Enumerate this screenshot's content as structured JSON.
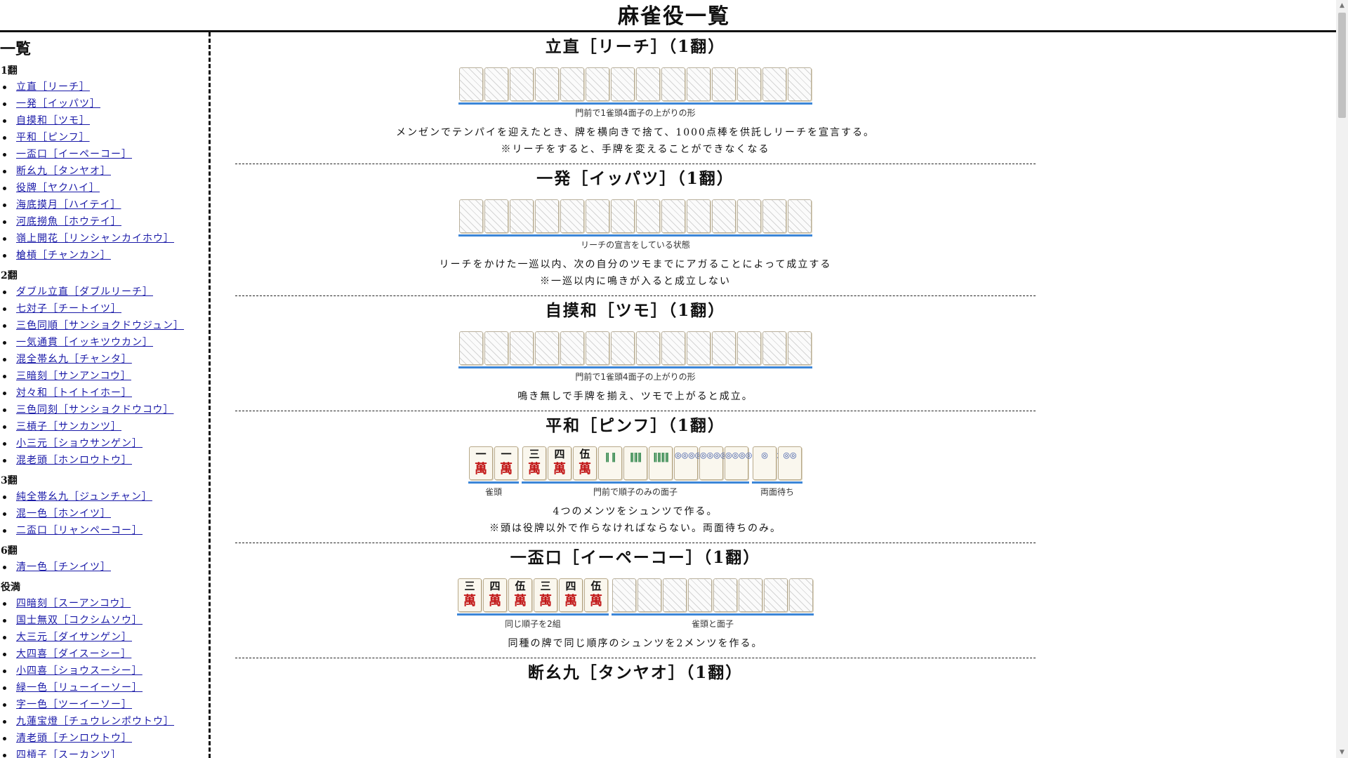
{
  "page": {
    "title": "麻雀役一覧"
  },
  "sidebar": {
    "heading": "一覧",
    "groups": [
      {
        "title": "1翻",
        "items": [
          "立直［リーチ］",
          "一発［イッパツ］",
          "自摸和［ツモ］",
          "平和［ピンフ］",
          "一盃口［イーペーコー］",
          "断幺九［タンヤオ］",
          "役牌［ヤクハイ］",
          "海底摸月［ハイテイ］",
          "河底撈魚［ホウテイ］",
          "嶺上開花［リンシャンカイホウ］",
          "槍槓［チャンカン］"
        ]
      },
      {
        "title": "2翻",
        "items": [
          "ダブル立直［ダブルリーチ］",
          "七対子［チートイツ］",
          "三色同順［サンショクドウジュン］",
          "一気通貫［イッキツウカン］",
          "混全帯幺九［チャンタ］",
          "三暗刻［サンアンコウ］",
          "対々和［トイトイホー］",
          "三色同刻［サンショクドウコウ］",
          "三槓子［サンカンツ］",
          "小三元［ショウサンゲン］",
          "混老頭［ホンロウトウ］"
        ]
      },
      {
        "title": "3翻",
        "items": [
          "純全帯幺九［ジュンチャン］",
          "混一色［ホンイツ］",
          "二盃口［リャンペーコー］"
        ]
      },
      {
        "title": "6翻",
        "items": [
          "清一色［チンイツ］"
        ]
      },
      {
        "title": "役満",
        "items": [
          "四暗刻［スーアンコウ］",
          "国士無双［コクシムソウ］",
          "大三元［ダイサンゲン］",
          "大四喜［ダイスーシー］",
          "小四喜［ショウスーシー］",
          "緑一色［リューイーソー］",
          "字一色［ツーイーソー］",
          "九蓮宝燈［チュウレンポウトウ］",
          "清老頭［チンロウトウ］",
          "四槓子［スーカンツ］"
        ]
      }
    ]
  },
  "yaku": [
    {
      "title": "立直［リーチ］（1翻）",
      "groups": [
        {
          "caption": "門前で1雀頭4面子の上がりの形",
          "tiles": [
            "blank",
            "blank",
            "blank",
            "blank",
            "blank",
            "blank",
            "blank",
            "blank",
            "blank",
            "blank",
            "blank",
            "blank",
            "blank",
            "blank"
          ]
        }
      ],
      "desc": [
        "メンゼンでテンパイを迎えたとき、牌を横向きで捨て、1000点棒を供託しリーチを宣言する。",
        "※リーチをすると、手牌を変えることができなくなる"
      ]
    },
    {
      "title": "一発［イッパツ］（1翻）",
      "groups": [
        {
          "caption": "リーチの宣言をしている状態",
          "tiles": [
            "blank",
            "blank",
            "blank",
            "blank",
            "blank",
            "blank",
            "blank",
            "blank",
            "blank",
            "blank",
            "blank",
            "blank",
            "blank",
            "blank"
          ]
        }
      ],
      "desc": [
        "リーチをかけた一巡以内、次の自分のツモまでにアガることによって成立する",
        "※一巡以内に鳴きが入ると成立しない"
      ]
    },
    {
      "title": "自摸和［ツモ］（1翻）",
      "groups": [
        {
          "caption": "門前で1雀頭4面子の上がりの形",
          "tiles": [
            "blank",
            "blank",
            "blank",
            "blank",
            "blank",
            "blank",
            "blank",
            "blank",
            "blank",
            "blank",
            "blank",
            "blank",
            "blank",
            "blank"
          ]
        }
      ],
      "desc": [
        "鳴き無しで手牌を揃え、ツモで上がると成立。"
      ]
    },
    {
      "title": "平和［ピンフ］（1翻）",
      "groups": [
        {
          "caption": "雀頭",
          "tiles": [
            "m1",
            "m1"
          ]
        },
        {
          "caption": "門前で順子のみの面子",
          "tiles": [
            "m3",
            "m4",
            "m5",
            "s2",
            "s3",
            "s4",
            "p6",
            "p7",
            "p8"
          ]
        },
        {
          "caption": "両面待ち",
          "tiles": [
            "p1",
            "p2"
          ]
        }
      ],
      "desc": [
        "4つのメンツをシュンツで作る。",
        "※頭は役牌以外で作らなければならない。両面待ちのみ。"
      ]
    },
    {
      "title": "一盃口［イーペーコー］（1翻）",
      "groups": [
        {
          "caption": "同じ順子を2組",
          "tiles": [
            "m3",
            "m4",
            "m5",
            "m3",
            "m4",
            "m5"
          ]
        },
        {
          "caption": "雀頭と面子",
          "tiles": [
            "blank",
            "blank",
            "blank",
            "blank",
            "blank",
            "blank",
            "blank",
            "blank"
          ]
        }
      ],
      "desc": [
        "同種の牌で同じ順序のシュンツを2メンツを作る。"
      ]
    },
    {
      "title": "断幺九［タンヤオ］（1翻）",
      "groups": [],
      "desc": []
    }
  ],
  "tile_glyphs": {
    "m1": {
      "top": "一",
      "bottom": "萬"
    },
    "m3": {
      "top": "三",
      "bottom": "萬"
    },
    "m4": {
      "top": "四",
      "bottom": "萬"
    },
    "m5": {
      "top": "伍",
      "bottom": "萬"
    },
    "s2": {
      "pattern": "‖ ‖"
    },
    "s3": {
      "pattern": "‖‖‖"
    },
    "s4": {
      "pattern": "‖‖‖‖"
    },
    "p1": {
      "pattern": "◎"
    },
    "p2": {
      "pattern": "◎◎"
    },
    "p6": {
      "pattern": "◎◎◎◎◎◎"
    },
    "p7": {
      "pattern": "◎◎◎◎◎◎◎"
    },
    "p8": {
      "pattern": "◎◎◎◎◎◎◎◎"
    }
  },
  "colors": {
    "underline": "#3c86d8",
    "link": "#1a1aa8",
    "man_red": "#c21818",
    "sou_green": "#1a7a3a",
    "pin_blue": "#2b4aa0"
  }
}
